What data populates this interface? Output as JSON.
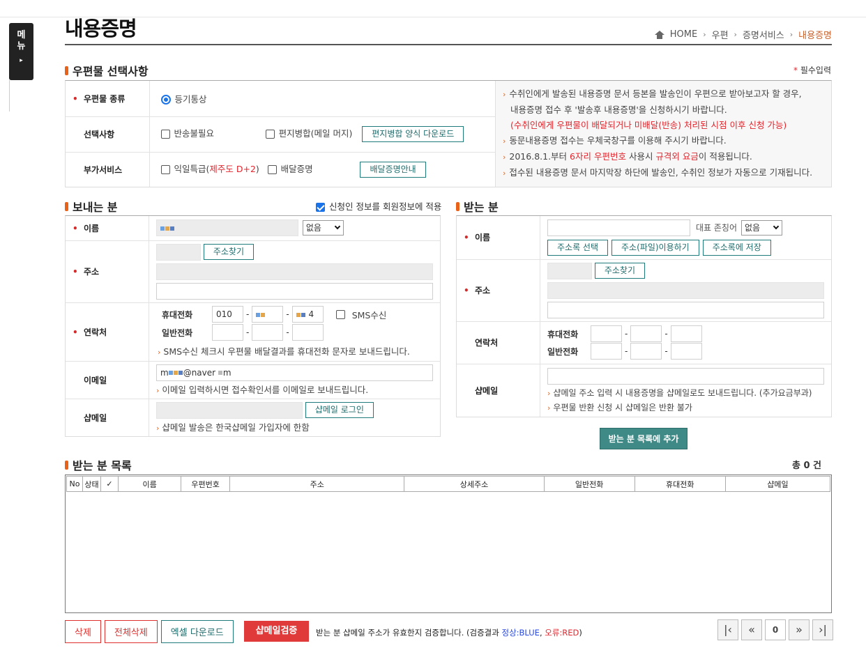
{
  "sidemenu": {
    "label_1": "메",
    "label_2": "뉴",
    "arrow": "▸"
  },
  "page_title": "내용증명",
  "breadcrumb": {
    "home": "HOME",
    "items": [
      "우편",
      "증명서비스",
      "내용증명"
    ],
    "sep": "›"
  },
  "section_mail": {
    "title": "우편물 선택사항",
    "required_mark": "*",
    "required_note": "필수입력",
    "rows": {
      "type_label": "우편물 종류",
      "type_value": "등기통상",
      "options_label": "선택사항",
      "opt_no_return": "반송불필요",
      "opt_merge": "편지병합(메일 머지)",
      "merge_download_btn": "편지병합 양식 다운로드",
      "extra_label": "부가서비스",
      "opt_express_prefix": "익일특급(",
      "opt_express_red": "제주도 D+2",
      "opt_express_suffix": ")",
      "opt_delivery_cert": "배달증명",
      "delivery_guide_btn": "배달증명안내"
    },
    "info": {
      "line1": "수취인에게 발송된 내용증명 문서 등본을 발송인이 우편으로 받아보고자 할 경우,",
      "line2": "내용증명 접수 후 '발송후 내용증명'을 신청하시기 바랍니다.",
      "line3": "(수취인에게 우편물이 배달되거나 미배달(반송) 처리된 시점 이후 신청 가능)",
      "line4": "동문내용증명 접수는 우체국창구를 이용해 주시기 바랍니다.",
      "line5_a": "2016.8.1.부터 ",
      "line5_b": "6자리 우편번호",
      "line5_c": " 사용시 ",
      "line5_d": "규격외 요금",
      "line5_e": "이 적용됩니다.",
      "line6": "접수된 내용증명 문서 마지막장 하단에 발송인, 수취인 정보가 자동으로 기재됩니다."
    }
  },
  "sender": {
    "title": "보내는 분",
    "apply_member_info": "신청인 정보를 회원정보에 적용",
    "name_label": "이름",
    "name_select": "없음",
    "address_label": "주소",
    "find_address_btn": "주소찾기",
    "contact_label": "연락처",
    "mobile_label": "휴대전화",
    "mobile_1": "010",
    "mobile_3": "4",
    "phone_label": "일반전화",
    "sms_label": "SMS수신",
    "sms_note": "SMS수신 체크시 우편물 배달결과를 휴대전화 문자로 보내드립니다.",
    "email_label": "이메일",
    "email_value_a": "m",
    "email_value_b": "@naver",
    "email_value_c": "m",
    "email_note": "이메일 입력하시면 접수확인서를 이메일로 보내드립니다.",
    "shopmail_label": "샵메일",
    "shopmail_login_btn": "샵메일 로그인",
    "shopmail_note": "샵메일 발송은 한국샵메일 가입자에 한함",
    "dash": "-"
  },
  "receiver": {
    "title": "받는 분",
    "name_label": "이름",
    "honorific_label": "대표 존칭어",
    "honorific_select": "없음",
    "addrbook_select_btn": "주소록 선택",
    "addr_file_btn": "주소(파일)이용하기",
    "addrbook_save_btn": "주소록에 저장",
    "address_label": "주소",
    "find_address_btn": "주소찾기",
    "contact_label": "연락처",
    "mobile_label": "휴대전화",
    "phone_label": "일반전화",
    "shopmail_label": "샵메일",
    "shopmail_note1": "샵메일 주소 입력 시 내용증명을 샵메일로도 보내드립니다. (추가요금부과)",
    "shopmail_note2": "우편물 반환 신청 시 샵메일은 반환 불가",
    "add_to_list_btn": "받는 분 목록에 추가",
    "dash": "-"
  },
  "recipient_list": {
    "title": "받는 분 목록",
    "total": "총 0 건",
    "columns": [
      "No",
      "상태",
      "✓",
      "이름",
      "우편번호",
      "주소",
      "상세주소",
      "일반전화",
      "휴대전화",
      "샵메일"
    ]
  },
  "bottom": {
    "delete_btn": "삭제",
    "delete_all_btn": "전체삭제",
    "excel_btn": "엑셀 다운로드",
    "shopmail_verify_btn": "샵메일검증",
    "verify_note_a": "받는 분 샵메일 주소가 유효한지 검증합니다. (검증결과 ",
    "verify_note_blue": "정상:BLUE",
    "verify_note_mid": ", ",
    "verify_note_red": "오류:RED",
    "verify_note_end": ")",
    "page_first": "|‹",
    "page_prev": "«",
    "page_num": "0",
    "page_next": "»",
    "page_last": "›|"
  },
  "colors": {
    "accent_orange": "#e8621a",
    "teal": "#1f7b7b",
    "red": "#e0262d",
    "verify_red": "#e03a3a"
  }
}
